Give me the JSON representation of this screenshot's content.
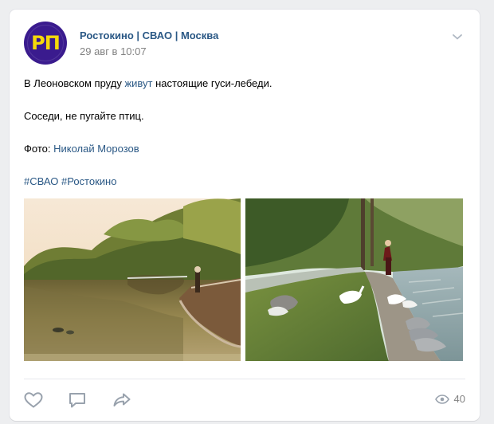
{
  "post": {
    "author": "Ростокино | СВАО | Москва",
    "date": "29 авг в 10:07",
    "avatar_text": "РП",
    "text_parts": {
      "line1_before": "В Леоновском пруду ",
      "line1_link": "живут",
      "line1_after": " настоящие гуси-лебеди.",
      "line2": "Соседи, не пугайте птиц.",
      "line3_label": "Фото: ",
      "line3_link": "Николай Морозов",
      "hashtag1": "#СВАО",
      "hashtag2": "#Ростокино"
    },
    "views": "40"
  },
  "colors": {
    "link": "#2a5885",
    "muted": "#828282",
    "avatar_bg": "#3a1b8e",
    "avatar_text": "#f5d90a",
    "icon": "#99a2ad"
  },
  "icons": {
    "menu": "chevron-down-icon",
    "like": "heart-icon",
    "comment": "comment-icon",
    "share": "share-icon",
    "views": "eye-icon"
  }
}
